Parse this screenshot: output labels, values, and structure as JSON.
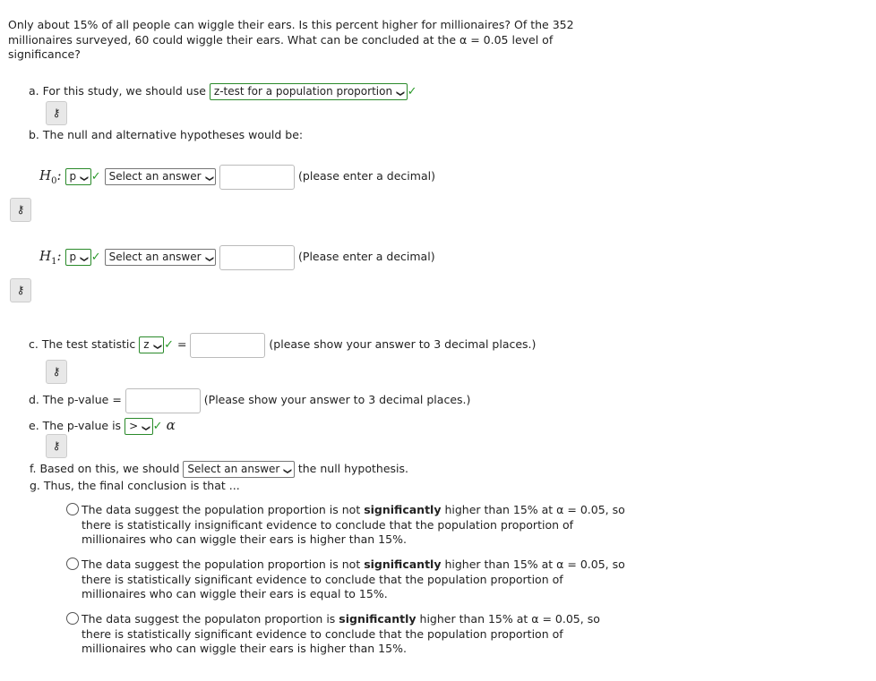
{
  "question": [
    "Only about 15% of all people can wiggle their ears. Is this percent higher for millionaires? Of the 352",
    "millionaires surveyed, 60 could wiggle their ears. What can be concluded at the α = 0.05 level of",
    "significance?"
  ],
  "a": {
    "label": "a. For this study, we should use",
    "value": "z-test for a population proportion"
  },
  "b": {
    "label": "b. The null and alternative hypotheses would be:",
    "h0": {
      "sym": "H",
      "sub": "0",
      "param": "p",
      "relation": "Select an answer",
      "hint": "(please enter a decimal)"
    },
    "h1": {
      "sym": "H",
      "sub": "1",
      "param": "p",
      "relation": "Select an answer",
      "hint": "(Please enter a decimal)"
    }
  },
  "c": {
    "label": "c. The test statistic",
    "value": "z",
    "eq": "=",
    "hint": "(please show your answer to 3 decimal places.)"
  },
  "d": {
    "label": "d. The p-value =",
    "hint": "(Please show your answer to 3 decimal places.)"
  },
  "e": {
    "label": "e. The p-value is",
    "value": ">",
    "alpha": "α"
  },
  "f": {
    "label": "f. Based on this, we should",
    "value": "Select an answer",
    "after": "the null hypothesis."
  },
  "g": {
    "label": "g. Thus, the final conclusion is that ..."
  },
  "options": [
    [
      "The data suggest the population proportion is not ",
      "significantly",
      " higher than 15% at α = 0.05, so",
      "there is statistically insignificant evidence to conclude that the population proportion of",
      "millionaires who can wiggle their ears is higher than 15%."
    ],
    [
      "The data suggest the population proportion is not ",
      "significantly",
      " higher than 15% at α = 0.05, so",
      "there is statistically significant evidence to conclude that the population proportion of",
      "millionaires who can wiggle their ears is equal to 15%."
    ],
    [
      "The data suggest the populaton proportion is ",
      "significantly",
      " higher than 15% at α = 0.05, so",
      "there is statistically significant evidence to conclude that the population proportion of",
      "millionaires who can wiggle their ears is higher than 15%."
    ]
  ],
  "icons": {
    "key": "key-icon",
    "check": "checkmark-icon",
    "chevron": "chevron-down-icon"
  },
  "colors": {
    "correct": "#2a9a2a"
  }
}
